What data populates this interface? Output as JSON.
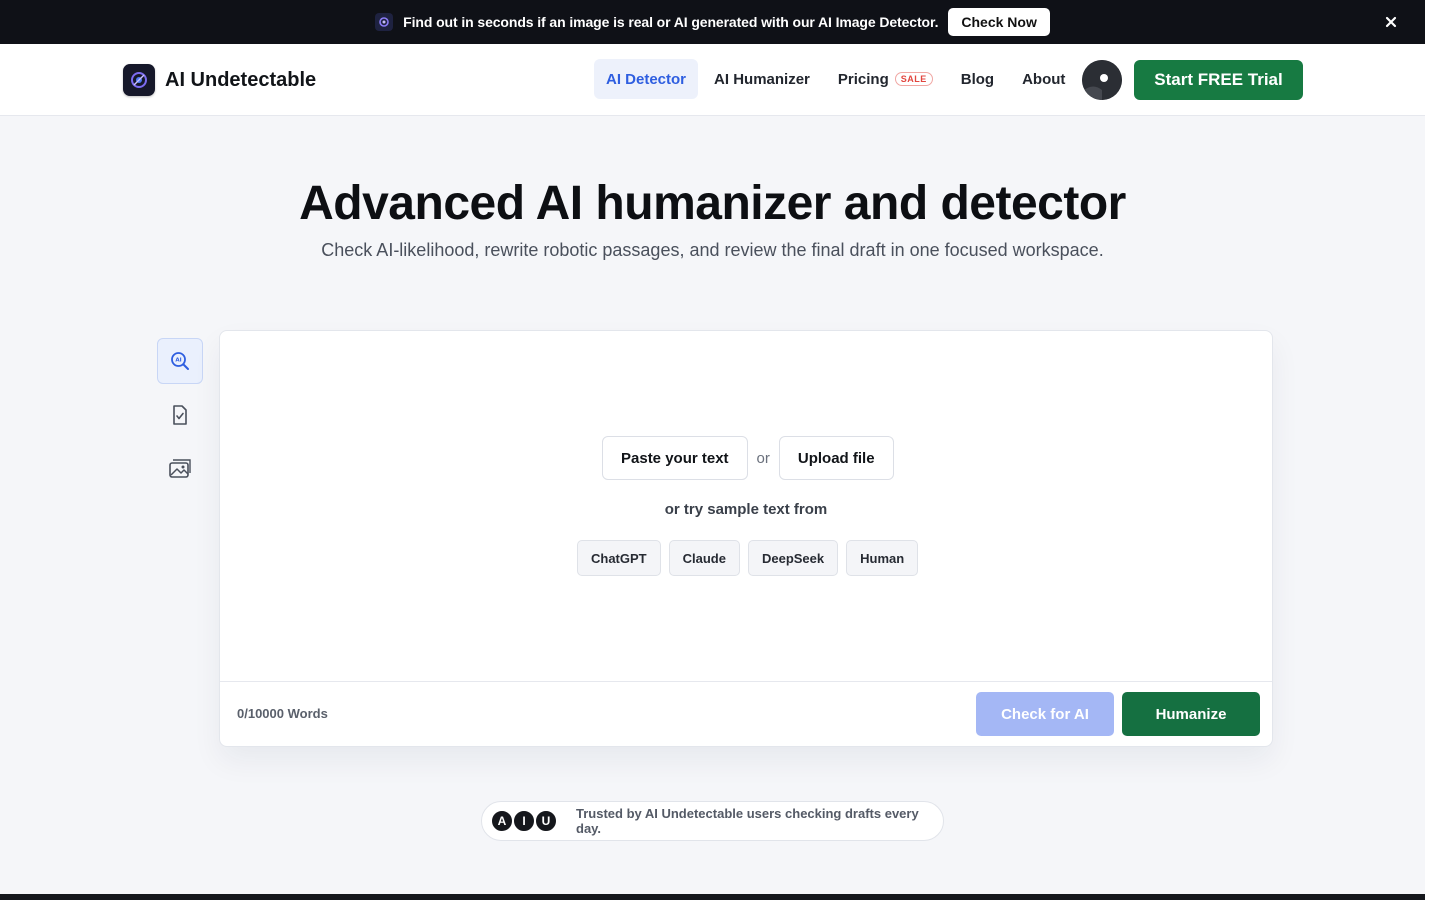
{
  "banner": {
    "text": "Find out in seconds if an image is real or AI generated with our AI Image Detector.",
    "button_label": "Check Now",
    "close_icon": "close-icon"
  },
  "header": {
    "brand": "AI Undetectable",
    "nav": [
      {
        "label": "AI Detector",
        "active": true
      },
      {
        "label": "AI Humanizer",
        "active": false
      },
      {
        "label": "Pricing",
        "badge": "SALE",
        "active": false
      },
      {
        "label": "Blog",
        "active": false
      },
      {
        "label": "About",
        "active": false
      }
    ],
    "cta_label": "Start FREE Trial"
  },
  "hero": {
    "title": "Advanced AI humanizer and detector",
    "subtitle": "Check AI-likelihood, rewrite robotic passages, and review the final draft in one focused workspace."
  },
  "tools": [
    {
      "icon": "ai-search-icon",
      "active": true
    },
    {
      "icon": "document-check-icon",
      "active": false
    },
    {
      "icon": "image-gallery-icon",
      "active": false
    }
  ],
  "workspace": {
    "paste_label": "Paste your text",
    "or_label": "or",
    "upload_label": "Upload file",
    "sample_label": "or try sample text from",
    "samples": [
      "ChatGPT",
      "Claude",
      "DeepSeek",
      "Human"
    ],
    "word_count": "0/10000 Words",
    "check_label": "Check for AI",
    "humanize_label": "Humanize"
  },
  "trust": {
    "avatars": [
      "A",
      "I",
      "U"
    ],
    "text": "Trusted by AI Undetectable users checking drafts every day."
  },
  "colors": {
    "primary_green": "#177a42",
    "accent_blue": "#2e5ee0",
    "check_disabled": "#a4b7f5",
    "sale_red": "#e2463f"
  }
}
